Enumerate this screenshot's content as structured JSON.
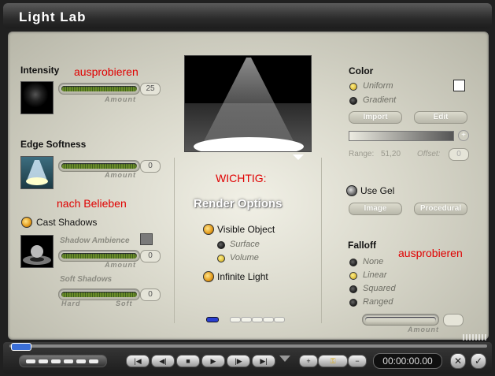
{
  "window": {
    "title": "Light Lab"
  },
  "left": {
    "intensity": {
      "label": "Intensity",
      "amount_label": "Amount",
      "value": "25"
    },
    "edge_softness": {
      "label": "Edge Softness",
      "amount_label": "Amount",
      "value": "0"
    },
    "cast_shadows": {
      "label": "Cast Shadows"
    },
    "shadow_ambience": {
      "label": "Shadow Ambience",
      "amount_label": "Amount",
      "value": "0"
    },
    "soft_shadows": {
      "label": "Soft Shadows",
      "hard_label": "Hard",
      "soft_label": "Soft",
      "value": "0"
    }
  },
  "annotations": {
    "try_intensity": "ausprobieren",
    "as_desired": "nach Belieben",
    "important": "WICHTIG:",
    "try_falloff": "ausprobieren"
  },
  "center": {
    "render_options_title": "Render Options",
    "visible_object": "Visible Object",
    "surface": "Surface",
    "volume": "Volume",
    "infinite_light": "Infinite Light"
  },
  "right": {
    "color": {
      "label": "Color",
      "uniform": "Uniform",
      "gradient": "Gradient",
      "import_button": "Import",
      "edit_button": "Edit",
      "range_label": "Range:",
      "range_value": "51,20",
      "offset_label": "Offset:",
      "offset_value": "0"
    },
    "use_gel": {
      "label": "Use Gel",
      "image_button": "Image",
      "procedural_button": "Procedural"
    },
    "falloff": {
      "label": "Falloff",
      "none": "None",
      "linear": "Linear",
      "squared": "Squared",
      "ranged": "Ranged",
      "amount_label": "Amount"
    }
  },
  "bottom": {
    "timecode": "00:00:00.00"
  },
  "colors": {
    "accent_red": "#e00000",
    "radio_orange": "#e39a1a",
    "panel_bg": "#d9d8cb"
  }
}
